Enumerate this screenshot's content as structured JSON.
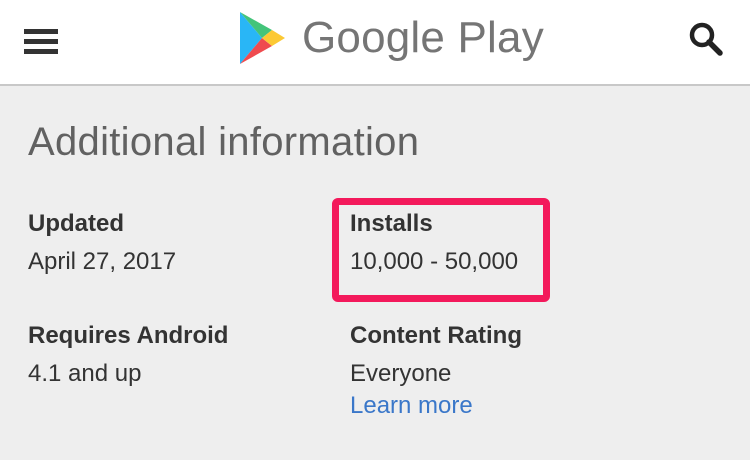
{
  "header": {
    "brand_name": "Google Play",
    "menu_icon": "hamburger-menu-icon",
    "search_icon": "search-icon",
    "logo_icon": "play-triangle-icon"
  },
  "additional_info": {
    "title": "Additional information",
    "updated": {
      "label": "Updated",
      "value": "April 27, 2017"
    },
    "installs": {
      "label": "Installs",
      "value": "10,000 - 50,000"
    },
    "requires_android": {
      "label": "Requires Android",
      "value": "4.1 and up"
    },
    "content_rating": {
      "label": "Content Rating",
      "value": "Everyone",
      "link": "Learn more"
    }
  },
  "colors": {
    "highlight": "#f3195b",
    "link": "#3a77c9",
    "background": "#eeeeee",
    "brand_text": "#757575"
  }
}
